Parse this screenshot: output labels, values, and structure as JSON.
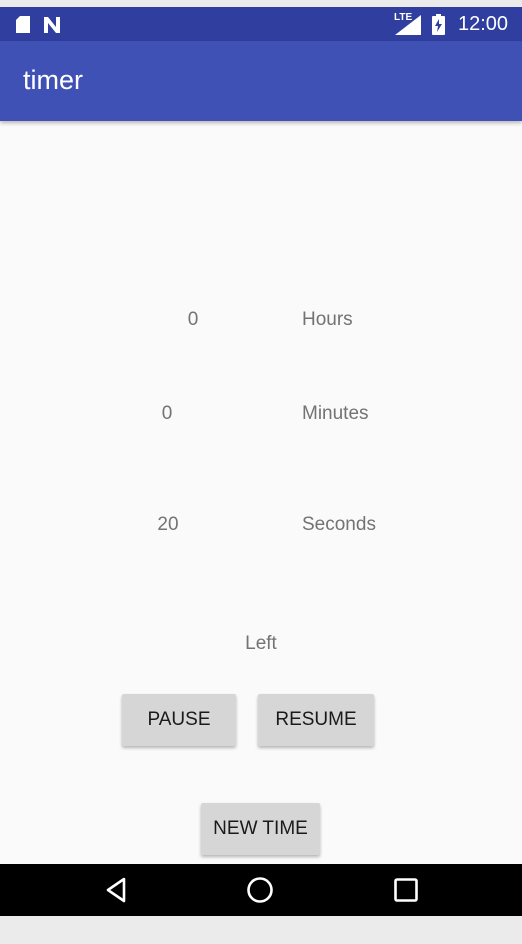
{
  "status_bar": {
    "time": "12:00",
    "network_label": "LTE",
    "icons": [
      "sd-card-icon",
      "n-notification-icon",
      "signal-icon",
      "battery-charging-icon"
    ]
  },
  "app_bar": {
    "title": "timer"
  },
  "timer": {
    "hours_value": "0",
    "hours_label": "Hours",
    "minutes_value": "0",
    "minutes_label": "Minutes",
    "seconds_value": "20",
    "seconds_label": "Seconds",
    "left_label": "Left"
  },
  "buttons": {
    "pause": "PAUSE",
    "resume": "RESUME",
    "new_time": "NEW TIME"
  },
  "nav_bar": {
    "icons": [
      "back-icon",
      "home-icon",
      "recents-icon"
    ]
  },
  "colors": {
    "status_bar": "#303f9f",
    "app_bar": "#3f51b5",
    "background": "#fafafa",
    "button": "#d6d6d6",
    "label_text": "#737373"
  }
}
